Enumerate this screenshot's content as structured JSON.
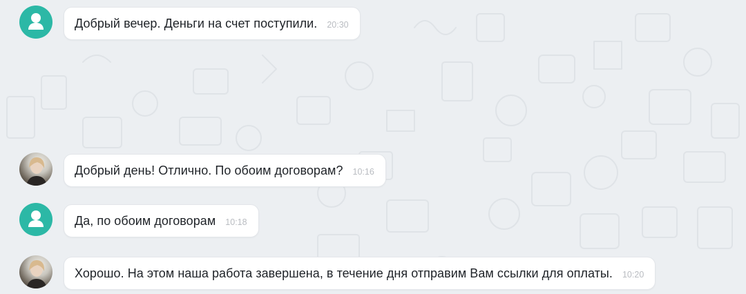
{
  "messages": [
    {
      "sender": "operator",
      "avatar_type": "generic",
      "text": "Добрый вечер. Деньги на счет поступили.",
      "time": "20:30"
    },
    {
      "sender": "client",
      "avatar_type": "photo",
      "text": "Добрый день! Отлично. По обоим договорам?",
      "time": "10:16"
    },
    {
      "sender": "operator",
      "avatar_type": "generic",
      "text": "Да, по обоим договорам",
      "time": "10:18"
    },
    {
      "sender": "client",
      "avatar_type": "photo",
      "text": "Хорошо. На этом наша работа завершена, в течение дня отправим Вам ссылки для оплаты.",
      "time": "10:20"
    }
  ],
  "colors": {
    "background": "#eceff2",
    "generic_avatar": "#2cb8a6",
    "bubble": "#ffffff",
    "text": "#1f2328",
    "time": "#b9bcc1"
  },
  "icons": [
    "user-silhouette-icon",
    "photo-avatar"
  ]
}
